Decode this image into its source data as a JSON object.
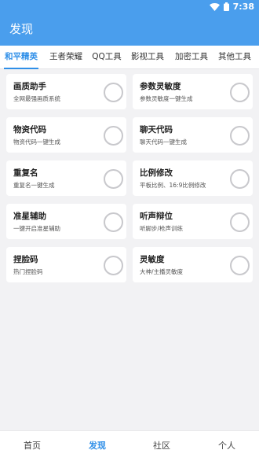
{
  "status": {
    "time": "7:38"
  },
  "appbar": {
    "title": "发现"
  },
  "tabs": [
    {
      "label": "和平精英"
    },
    {
      "label": "王者荣耀"
    },
    {
      "label": "QQ工具"
    },
    {
      "label": "影视工具"
    },
    {
      "label": "加密工具"
    },
    {
      "label": "其他工具"
    }
  ],
  "cards": [
    {
      "title": "画质助手",
      "subtitle": "全网最强画质系统"
    },
    {
      "title": "参数灵敏度",
      "subtitle": "参数灵敏度一键生成"
    },
    {
      "title": "物资代码",
      "subtitle": "物资代码一键生成"
    },
    {
      "title": "聊天代码",
      "subtitle": "聊天代码一键生成"
    },
    {
      "title": "重复名",
      "subtitle": "重复名一键生成"
    },
    {
      "title": "比例修改",
      "subtitle": "平板比例、16:9比例修改"
    },
    {
      "title": "准星辅助",
      "subtitle": "一键开启准星辅助"
    },
    {
      "title": "听声辩位",
      "subtitle": "听脚步/枪声训练"
    },
    {
      "title": "捏脸码",
      "subtitle": "热门捏脸码"
    },
    {
      "title": "灵敏度",
      "subtitle": "大神/主播灵敏度"
    }
  ],
  "bottom_nav": [
    {
      "label": "首页"
    },
    {
      "label": "发现"
    },
    {
      "label": "社区"
    },
    {
      "label": "个人"
    }
  ],
  "colors": {
    "primary": "#4a9eed",
    "accent": "#2f8fe8",
    "background": "#f2f2f4"
  }
}
